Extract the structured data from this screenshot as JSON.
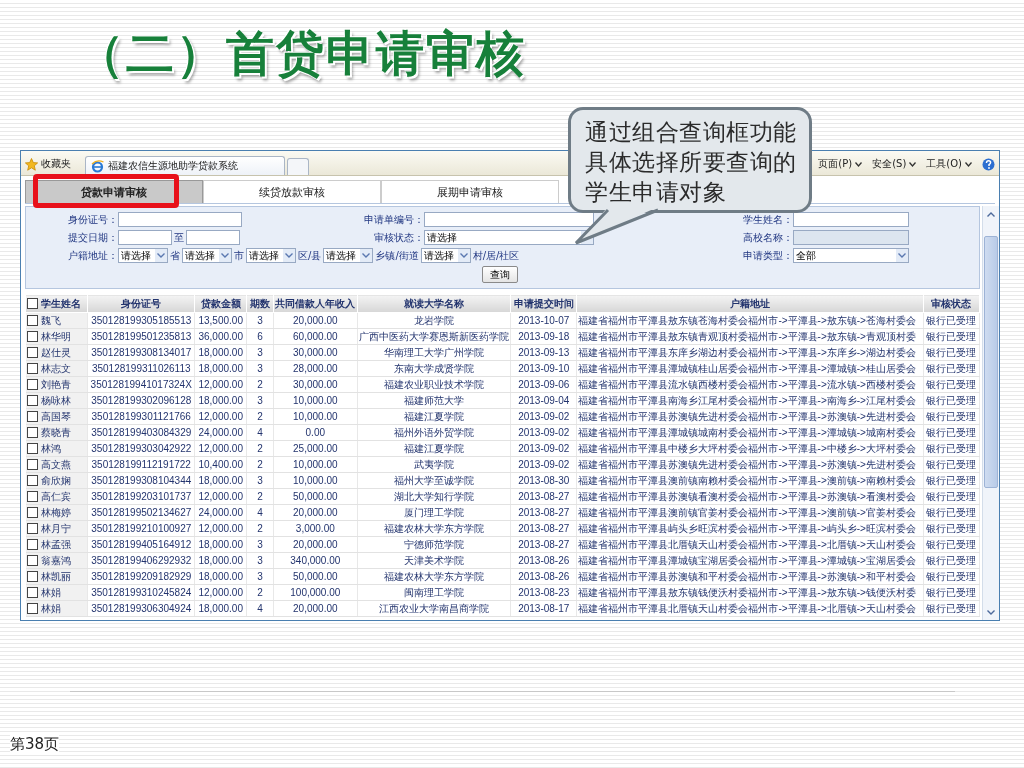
{
  "slide_title": "（二）首贷申请审核",
  "browser": {
    "favorites": "收藏夹",
    "tab_title": "福建农信生源地助学贷款系统",
    "menus": [
      "页面(P)",
      "安全(S)",
      "工具(O)"
    ]
  },
  "tabs": [
    {
      "label": "贷款申请审核",
      "selected": true
    },
    {
      "label": "续贷放款审核",
      "selected": false
    },
    {
      "label": "展期申请审核",
      "selected": false
    }
  ],
  "search_form": {
    "id_label": "身份证号：",
    "application_no_label": "申请单编号：",
    "student_name_label": "学生姓名：",
    "date_label": "提交日期：",
    "date_separator": "至",
    "status_label": "审核状态：",
    "status_value": "请选择",
    "school_label": "高校名称：",
    "school_disabled": true,
    "address_label": "户籍地址：",
    "address_parts": [
      {
        "value": "请选择",
        "unit": "省"
      },
      {
        "value": "请选择",
        "unit": "市"
      },
      {
        "value": "请选择",
        "unit": "区/县"
      },
      {
        "value": "请选择",
        "unit": "乡镇/街道"
      },
      {
        "value": "请选择",
        "unit": "村/居/社区"
      }
    ],
    "type_label": "申请类型：",
    "type_value": "全部",
    "search_button": "查询"
  },
  "table": {
    "select_all_checked": false,
    "columns": [
      "学生姓名",
      "身份证号",
      "贷款金额",
      "期数",
      "共同借款人年收入",
      "就读大学名称",
      "申请提交时间",
      "户籍地址",
      "审核状态"
    ],
    "rows": [
      {
        "checked": false,
        "cells": [
          "魏飞",
          "350128199305185513",
          "13,500.00",
          "3",
          "20,000.00",
          "龙岩学院",
          "2013-10-07",
          "福建省福州市平潭县敖东镇苍海村委会福州市->平潭县->敖东镇->苍海村委会",
          "银行已受理"
        ]
      },
      {
        "checked": false,
        "cells": [
          "林华明",
          "350128199501235813",
          "36,000.00",
          "6",
          "60,000.00",
          "广西中医药大学赛恩斯新医药学院",
          "2013-09-18",
          "福建省福州市平潭县敖东镇青观顶村委福州市->平潭县->敖东镇->青观顶村委",
          "银行已受理"
        ]
      },
      {
        "checked": false,
        "cells": [
          "赵仕灵",
          "350128199308134017",
          "18,000.00",
          "3",
          "30,000.00",
          "华南理工大学广州学院",
          "2013-09-13",
          "福建省福州市平潭县东庠乡湖边村委会福州市->平潭县->东庠乡->湖边村委会",
          "银行已受理"
        ]
      },
      {
        "checked": false,
        "cells": [
          "林志文",
          "350128199311026113",
          "18,000.00",
          "3",
          "28,000.00",
          "东南大学成贤学院",
          "2013-09-10",
          "福建省福州市平潭县潭城镇桂山居委会福州市->平潭县->潭城镇->桂山居委会",
          "银行已受理"
        ]
      },
      {
        "checked": false,
        "cells": [
          "刘艳青",
          "35012819941017324X",
          "12,000.00",
          "2",
          "30,000.00",
          "福建农业职业技术学院",
          "2013-09-06",
          "福建省福州市平潭县流水镇西楼村委会福州市->平潭县->流水镇->西楼村委会",
          "银行已受理"
        ]
      },
      {
        "checked": false,
        "cells": [
          "杨咏林",
          "350128199302096128",
          "18,000.00",
          "3",
          "10,000.00",
          "福建师范大学",
          "2013-09-04",
          "福建省福州市平潭县南海乡江尾村委会福州市->平潭县->南海乡->江尾村委会",
          "银行已受理"
        ]
      },
      {
        "checked": false,
        "cells": [
          "高国琴",
          "350128199301121766",
          "12,000.00",
          "2",
          "10,000.00",
          "福建江夏学院",
          "2013-09-02",
          "福建省福州市平潭县苏澳镇先进村委会福州市->平潭县->苏澳镇->先进村委会",
          "银行已受理"
        ]
      },
      {
        "checked": false,
        "cells": [
          "蔡晓青",
          "350128199403084329",
          "24,000.00",
          "4",
          "0.00",
          "福州外语外贸学院",
          "2013-09-02",
          "福建省福州市平潭县潭城镇城南村委会福州市->平潭县->潭城镇->城南村委会",
          "银行已受理"
        ]
      },
      {
        "checked": false,
        "cells": [
          "林鸿",
          "350128199303042922",
          "12,000.00",
          "2",
          "25,000.00",
          "福建江夏学院",
          "2013-09-02",
          "福建省福州市平潭县中楼乡大坪村委会福州市->平潭县->中楼乡->大坪村委会",
          "银行已受理"
        ]
      },
      {
        "checked": false,
        "cells": [
          "高文燕",
          "350128199112191722",
          "10,400.00",
          "2",
          "10,000.00",
          "武夷学院",
          "2013-09-02",
          "福建省福州市平潭县苏澳镇先进村委会福州市->平潭县->苏澳镇->先进村委会",
          "银行已受理"
        ]
      },
      {
        "checked": false,
        "cells": [
          "俞欣娴",
          "350128199308104344",
          "18,000.00",
          "3",
          "10,000.00",
          "福州大学至诚学院",
          "2013-08-30",
          "福建省福州市平潭县澳前镇南赖村委会福州市->平潭县->澳前镇->南赖村委会",
          "银行已受理"
        ]
      },
      {
        "checked": false,
        "cells": [
          "高仁宾",
          "350128199203101737",
          "12,000.00",
          "2",
          "50,000.00",
          "湖北大学知行学院",
          "2013-08-27",
          "福建省福州市平潭县苏澳镇看澳村委会福州市->平潭县->苏澳镇->看澳村委会",
          "银行已受理"
        ]
      },
      {
        "checked": false,
        "cells": [
          "林梅婷",
          "350128199502134627",
          "24,000.00",
          "4",
          "20,000.00",
          "厦门理工学院",
          "2013-08-27",
          "福建省福州市平潭县澳前镇官姜村委会福州市->平潭县->澳前镇->官姜村委会",
          "银行已受理"
        ]
      },
      {
        "checked": false,
        "cells": [
          "林月宁",
          "350128199210100927",
          "12,000.00",
          "2",
          "3,000.00",
          "福建农林大学东方学院",
          "2013-08-27",
          "福建省福州市平潭县屿头乡旺滨村委会福州市->平潭县->屿头乡->旺滨村委会",
          "银行已受理"
        ]
      },
      {
        "checked": false,
        "cells": [
          "林孟强",
          "350128199405164912",
          "18,000.00",
          "3",
          "20,000.00",
          "宁德师范学院",
          "2013-08-27",
          "福建省福州市平潭县北厝镇天山村委会福州市->平潭县->北厝镇->天山村委会",
          "银行已受理"
        ]
      },
      {
        "checked": false,
        "cells": [
          "翁嘉鸿",
          "350128199406292932",
          "18,000.00",
          "3",
          "340,000.00",
          "天津美术学院",
          "2013-08-26",
          "福建省福州市平潭县潭城镇宝湖居委会福州市->平潭县->潭城镇->宝湖居委会",
          "银行已受理"
        ]
      },
      {
        "checked": false,
        "cells": [
          "林凯丽",
          "350128199209182929",
          "18,000.00",
          "3",
          "50,000.00",
          "福建农林大学东方学院",
          "2013-08-26",
          "福建省福州市平潭县苏澳镇和平村委会福州市->平潭县->苏澳镇->和平村委会",
          "银行已受理"
        ]
      },
      {
        "checked": false,
        "cells": [
          "林娟",
          "350128199310245824",
          "12,000.00",
          "2",
          "100,000.00",
          "闽南理工学院",
          "2013-08-23",
          "福建省福州市平潭县敖东镇钱便沃村委福州市->平潭县->敖东镇->钱便沃村委",
          "银行已受理"
        ]
      },
      {
        "checked": false,
        "cells": [
          "林娟",
          "350128199306304924",
          "18,000.00",
          "4",
          "20,000.00",
          "江西农业大学南昌商学院",
          "2013-08-17",
          "福建省福州市平潭县北厝镇天山村委会福州市->平潭县->北厝镇->天山村委会",
          "银行已受理"
        ]
      }
    ]
  },
  "callout": "通过组合查询框功能具体选择所要查询的学生申请对象",
  "page_number": "第38页"
}
